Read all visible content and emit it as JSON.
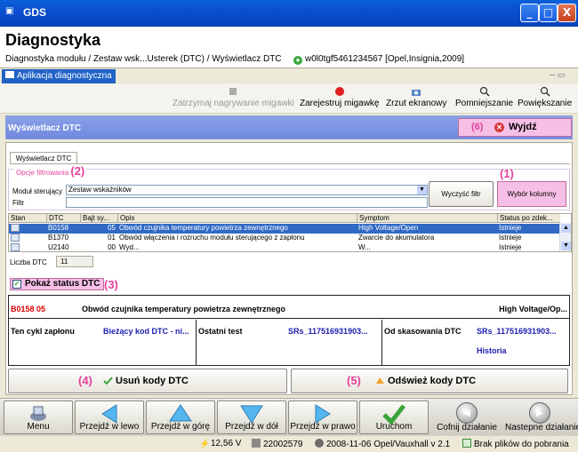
{
  "window": {
    "title": "GDS",
    "icon": "gds-app-icon",
    "min": "_",
    "max": "□",
    "close": "X"
  },
  "header": {
    "title": "Diagnostyka",
    "breadcrumb": "Diagnostyka modułu / Zestaw wsk...Usterek (DTC) / Wyświetlacz DTC",
    "vehicle": "w0l0tgf5461234567 [Opel,Insignia,2009]"
  },
  "app_tab": {
    "label": "Aplikacja diagnostyczna",
    "winctl": "─ ▭"
  },
  "toolbar": {
    "stop_recording": "Zatrzymaj nagrywanie migawki",
    "record_snapshot": "Zarejestruj migawkę",
    "screenshot": "Zrzut ekranowy",
    "zoom_out": "Pomniejszanie",
    "zoom_in": "Powiększanie"
  },
  "dtc_bar": {
    "label": "Wyświetlacz DTC",
    "exit_num": "(6)",
    "exit_label": "Wyjdź"
  },
  "subtab": "Wyświetlacz DTC",
  "filter": {
    "legend": "Opcje filtrowania",
    "legend_num": "(2)",
    "module_label": "Moduł sterujący",
    "module_value": "Zestaw wskaźników",
    "filter_label": "Filtr",
    "filter_value": "",
    "clear_button": "Wyczyść filtr",
    "columns_num": "(1)",
    "columns_button": "Wybór kolumny"
  },
  "table": {
    "headers": [
      "Stan",
      "DTC",
      "Bajt sy...",
      "Opis",
      "Symptom",
      "Status po zdek..."
    ],
    "rows": [
      [
        "",
        "B0158",
        "05",
        "Obwód czujnika temperatury powietrza zewnętrznego",
        "High Voltage/Open",
        "Istnieje"
      ],
      [
        "",
        "B1370",
        "01",
        "Obwód włączenia i rozruchu modułu sterującego z zapłonu",
        "Zwarcie do akumulatora",
        "Istnieje"
      ],
      [
        "",
        "U2140",
        "00",
        "Wyd...",
        "W...",
        "Istnieje"
      ]
    ]
  },
  "count": {
    "label": "Liczba DTC",
    "value": "11"
  },
  "show_status": {
    "label": "Pokaż status DTC",
    "num": "(3)",
    "checked": "✓"
  },
  "detail": {
    "code": "B0158 05",
    "description": "Obwód czujnika temperatury powietrza zewnętrznego",
    "symptom": "High Voltage/Op...",
    "ignition_label": "Ten cykl zapłonu",
    "ignition_value": "Bieżący kod DTC - ni...",
    "last_test_label": "Ostatni test",
    "last_test_value": "SRs_117516931903...",
    "since_clear_label": "Od skasowania DTC",
    "since_clear_value": "SRs_117516931903...",
    "history": "Historia"
  },
  "actions": {
    "delete_num": "(4)",
    "delete_label": "Usuń kody DTC",
    "refresh_num": "(5)",
    "refresh_label": "Odśwież kody DTC"
  },
  "nav": {
    "menu": "Menu",
    "left": "Przejdź w lewo",
    "up": "Przejdź w górę",
    "down": "Przejdź w dół",
    "right": "Przejdź w prawo",
    "run": "Uruchom",
    "undo": "Cofnij działanie",
    "next": "Nastepne działanie"
  },
  "status": {
    "voltage": "12,56 V",
    "id": "22002579",
    "version": "2008-11-06 Opel/Vauxhall v 2.1",
    "downloads": "Brak plików do pobrania"
  },
  "colors": {
    "accent_pink": "#e5409b",
    "button_pink": "#f6bfe6",
    "title_blue": "#0a4fd0",
    "link_blue": "#1c1cb0",
    "dtc_red": "#dd0000"
  }
}
